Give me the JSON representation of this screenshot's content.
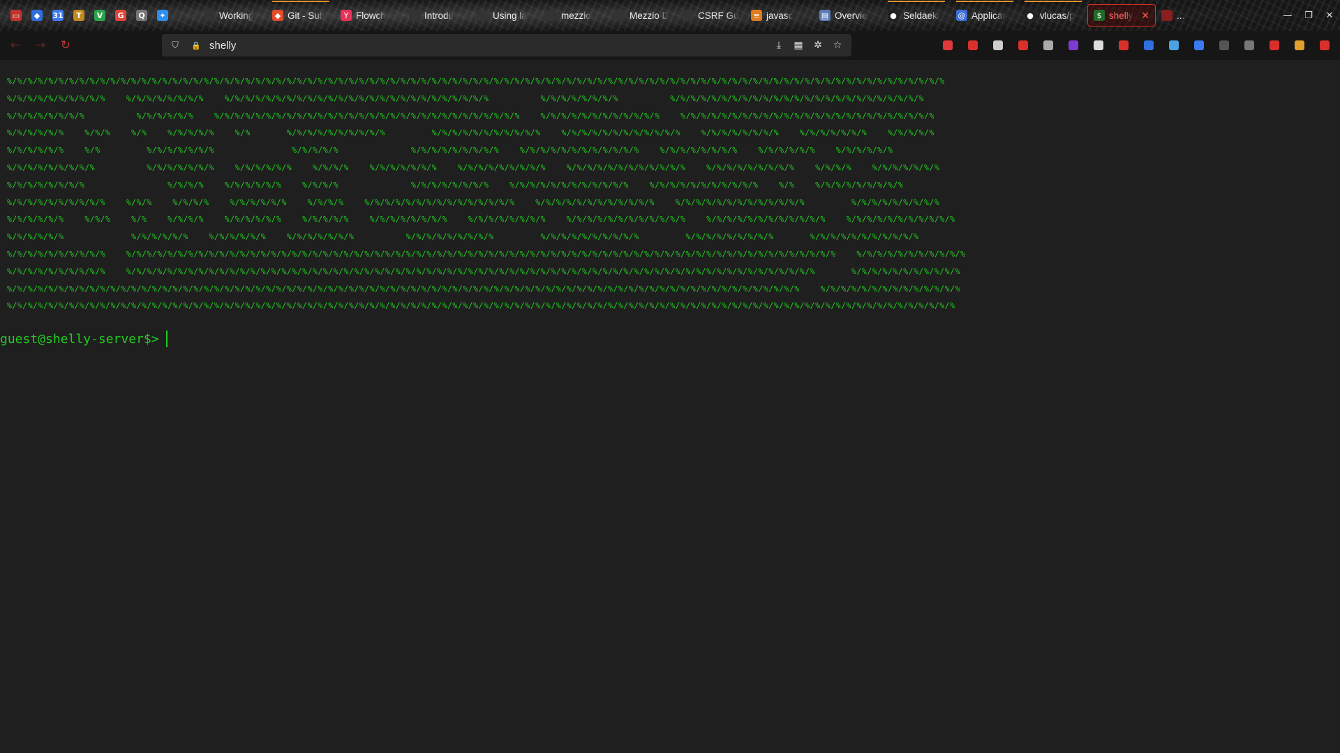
{
  "tabbar": {
    "pinned": [
      {
        "icon": "firefox-view-icon",
        "glyph": "▭",
        "color": "#c0342d"
      },
      {
        "icon": "dropbox-icon",
        "glyph": "◆",
        "color": "#2f6fe0"
      },
      {
        "icon": "google-calendar-icon",
        "glyph": "31",
        "color": "#3b7bf0"
      },
      {
        "icon": "trello-icon",
        "glyph": "T",
        "color": "#c08a1e"
      },
      {
        "icon": "vpn-icon",
        "glyph": "V",
        "color": "#2aa34a"
      },
      {
        "icon": "google-icon",
        "glyph": "G",
        "color": "#e04438"
      },
      {
        "icon": "search-app-icon",
        "glyph": "Q",
        "color": "#777777"
      },
      {
        "icon": "bluesky-icon",
        "glyph": "✦",
        "color": "#2b8ef0"
      }
    ],
    "tabs": [
      {
        "title": "Working",
        "favicon": "circle-tab-icon",
        "glyph": "",
        "color": "#333333",
        "loading": false
      },
      {
        "title": "Git - Sub",
        "favicon": "git-icon",
        "glyph": "◆",
        "color": "#e24c2a",
        "loading": true
      },
      {
        "title": "Flowch",
        "favicon": "flowchart-icon",
        "glyph": "Y",
        "color": "#e6335a",
        "loading": false
      },
      {
        "title": "Introdu",
        "favicon": "page-icon",
        "glyph": "",
        "color": "#333333",
        "loading": false
      },
      {
        "title": "Using la",
        "favicon": "page-icon",
        "glyph": "",
        "color": "#333333",
        "loading": false
      },
      {
        "title": "mezzio",
        "favicon": "page-icon",
        "glyph": "",
        "color": "#333333",
        "loading": false
      },
      {
        "title": "Mezzio D",
        "favicon": "page-icon",
        "glyph": "",
        "color": "#333333",
        "loading": false
      },
      {
        "title": "CSRF Gu",
        "favicon": "page-icon",
        "glyph": "",
        "color": "#333333",
        "loading": false
      },
      {
        "title": "javasc",
        "favicon": "stackoverflow-icon",
        "glyph": "≡",
        "color": "#e07b1e",
        "loading": false
      },
      {
        "title": "Overvie",
        "favicon": "docs-icon",
        "glyph": "▤",
        "color": "#5a7bb5",
        "loading": false
      },
      {
        "title": "Seldaek/",
        "favicon": "github-icon",
        "glyph": "●",
        "color": "#222222",
        "loading": true
      },
      {
        "title": "Applicat",
        "favicon": "app-icon",
        "glyph": "@",
        "color": "#3b6ed8",
        "loading": true
      },
      {
        "title": "vlucas/p",
        "favicon": "github-icon",
        "glyph": "●",
        "color": "#222222",
        "loading": true
      },
      {
        "title": "shelly",
        "favicon": "terminal-icon",
        "glyph": "$",
        "color": "#1f6b2a",
        "loading": false,
        "active": true
      }
    ],
    "extra_tab": {
      "title": "...",
      "favicon": "red-icon",
      "glyph": "",
      "color": "#8a1f1f"
    },
    "window_controls": {
      "minimize": "—",
      "restore": "❐",
      "close": "✕"
    }
  },
  "nav": {
    "back": "←",
    "forward": "→",
    "reload": "↻",
    "url": "shelly",
    "shield": "⛉",
    "lock": "🔒",
    "url_actions": [
      {
        "name": "save-to-pocket-icon",
        "glyph": "⤓"
      },
      {
        "name": "qr-code-icon",
        "glyph": "▦"
      },
      {
        "name": "bug-icon",
        "glyph": "✲"
      },
      {
        "name": "bookmark-star-icon",
        "glyph": "☆"
      }
    ]
  },
  "extensions": [
    {
      "name": "pocket-icon",
      "color": "#e0393b"
    },
    {
      "name": "downloads-icon",
      "color": "#d9302b"
    },
    {
      "name": "account-icon",
      "color": "#cccccc"
    },
    {
      "name": "extensions-puzzle-icon",
      "color": "#d9302b"
    },
    {
      "name": "library-icon",
      "color": "#aaaaaa"
    },
    {
      "name": "purple-extension-icon",
      "color": "#7d3bd1"
    },
    {
      "name": "cloud-extension-icon",
      "color": "#dddddd"
    },
    {
      "name": "ublock-icon",
      "color": "#d9302b"
    },
    {
      "name": "bitwarden-icon",
      "color": "#2f6fe0"
    },
    {
      "name": "container-icon",
      "color": "#4aa3e0"
    },
    {
      "name": "dark-reader-icon",
      "color": "#3b7bf0"
    },
    {
      "name": "grid-icon",
      "color": "#555555"
    },
    {
      "name": "tree-style-icon",
      "color": "#777777"
    },
    {
      "name": "noscript-icon",
      "color": "#d9302b"
    },
    {
      "name": "image-extension-icon",
      "color": "#e0a02b"
    },
    {
      "name": "menu-icon",
      "color": "#d9302b"
    }
  ],
  "terminal": {
    "banner_lines": [
      "%/%/%/%/%/%/%/%/%/%/%/%/%/%/%/%/%/%/%/%/%/%/%/%/%/%/%/%/%/%/%/%/%/%/%/%/%/%/%/%/%/%/%/%/%/%/%/%/%/%/%/%/%/%/%/%/%/%/%/%/%/%/%/%/%/%/%/%/%/%/%/%/%/%/%/%/%/%/%/%/%/%/%/%/%/%/%/%/%/%/%",
      "%/%/%/%/%/%/%/%/%/%    %/%/%/%/%/%/%/%    %/%/%/%/%/%/%/%/%/%/%/%/%/%/%/%/%/%/%/%/%/%/%/%/%/%          %/%/%/%/%/%/%/%          %/%/%/%/%/%/%/%/%/%/%/%/%/%/%/%/%/%/%/%/%/%/%/%/%",
      "%/%/%/%/%/%/%/%          %/%/%/%/%/%    %/%/%/%/%/%/%/%/%/%/%/%/%/%/%/%/%/%/%/%/%/%/%/%/%/%/%/%/%/%    %/%/%/%/%/%/%/%/%/%/%/%    %/%/%/%/%/%/%/%/%/%/%/%/%/%/%/%/%/%/%/%/%/%/%/%/%",
      "%/%/%/%/%/%    %/%/%    %/%    %/%/%/%/%    %/%       %/%/%/%/%/%/%/%/%/%         %/%/%/%/%/%/%/%/%/%/%    %/%/%/%/%/%/%/%/%/%/%/%    %/%/%/%/%/%/%/%    %/%/%/%/%/%/%    %/%/%/%/%",
      "%/%/%/%/%/%    %/%         %/%/%/%/%/%/%               %/%/%/%/%              %/%/%/%/%/%/%/%/%    %/%/%/%/%/%/%/%/%/%/%/%    %/%/%/%/%/%/%/%    %/%/%/%/%/%    %/%/%/%/%/%",
      "%/%/%/%/%/%/%/%/%          %/%/%/%/%/%/%    %/%/%/%/%/%    %/%/%/%    %/%/%/%/%/%/%    %/%/%/%/%/%/%/%/%    %/%/%/%/%/%/%/%/%/%/%/%    %/%/%/%/%/%/%/%/%    %/%/%/%    %/%/%/%/%/%/%",
      "%/%/%/%/%/%/%/%                %/%/%/%    %/%/%/%/%/%    %/%/%/%              %/%/%/%/%/%/%/%    %/%/%/%/%/%/%/%/%/%/%/%    %/%/%/%/%/%/%/%/%/%/%    %/%    %/%/%/%/%/%/%/%/%",
      "%/%/%/%/%/%/%/%/%/%    %/%/%    %/%/%/%    %/%/%/%/%/%    %/%/%/%    %/%/%/%/%/%/%/%/%/%/%/%/%/%/%    %/%/%/%/%/%/%/%/%/%/%/%    %/%/%/%/%/%/%/%/%/%/%/%/%         %/%/%/%/%/%/%/%/%",
      "%/%/%/%/%/%    %/%/%    %/%    %/%/%/%    %/%/%/%/%/%    %/%/%/%/%    %/%/%/%/%/%/%/%    %/%/%/%/%/%/%/%    %/%/%/%/%/%/%/%/%/%/%/%    %/%/%/%/%/%/%/%/%/%/%/%    %/%/%/%/%/%/%/%/%/%/%",
      "%/%/%/%/%/%             %/%/%/%/%/%    %/%/%/%/%/%    %/%/%/%/%/%/%          %/%/%/%/%/%/%/%/%         %/%/%/%/%/%/%/%/%/%         %/%/%/%/%/%/%/%/%       %/%/%/%/%/%/%/%/%/%/%",
      "%/%/%/%/%/%/%/%/%/%    %/%/%/%/%/%/%/%/%/%/%/%/%/%/%/%/%/%/%/%/%/%/%/%/%/%/%/%/%/%/%/%/%/%/%/%/%/%/%/%/%/%/%/%/%/%/%/%/%/%/%/%/%/%/%/%/%/%/%/%/%/%/%/%/%/%/%/%/%    %/%/%/%/%/%/%/%/%/%/%",
      "%/%/%/%/%/%/%/%/%/%    %/%/%/%/%/%/%/%/%/%/%/%/%/%/%/%/%/%/%/%/%/%/%/%/%/%/%/%/%/%/%/%/%/%/%/%/%/%/%/%/%/%/%/%/%/%/%/%/%/%/%/%/%/%/%/%/%/%/%/%/%/%/%/%/%/%/%       %/%/%/%/%/%/%/%/%/%/%",
      "%/%/%/%/%/%/%/%/%/%/%/%/%/%/%/%/%/%/%/%/%/%/%/%/%/%/%/%/%/%/%/%/%/%/%/%/%/%/%/%/%/%/%/%/%/%/%/%/%/%/%/%/%/%/%/%/%/%/%/%/%/%/%/%/%/%/%/%/%/%/%/%/%/%/%/%/%    %/%/%/%/%/%/%/%/%/%/%/%/%/%",
      "%/%/%/%/%/%/%/%/%/%/%/%/%/%/%/%/%/%/%/%/%/%/%/%/%/%/%/%/%/%/%/%/%/%/%/%/%/%/%/%/%/%/%/%/%/%/%/%/%/%/%/%/%/%/%/%/%/%/%/%/%/%/%/%/%/%/%/%/%/%/%/%/%/%/%/%/%/%/%/%/%/%/%/%/%/%/%/%/%/%/%/%"
    ],
    "prompt": "guest@shelly-server$>",
    "input": ""
  }
}
